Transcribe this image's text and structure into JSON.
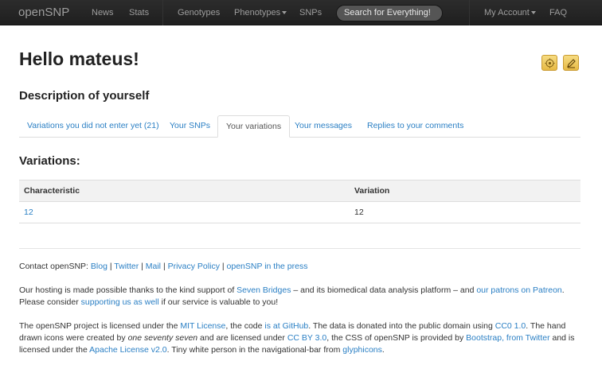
{
  "navbar": {
    "brand": "openSNP",
    "left_items": [
      "News",
      "Stats"
    ],
    "genotypes": "Genotypes",
    "phenotypes": "Phenotypes",
    "snps": "SNPs",
    "search_placeholder": "Search for Everything!",
    "account": "My Account",
    "faq": "FAQ"
  },
  "page": {
    "title": "Hello mateus!",
    "subtitle": "Description of yourself",
    "icons": [
      "settings-icon",
      "edit-icon"
    ]
  },
  "tabs": [
    {
      "label": "Variations you did not enter yet (21)",
      "active": false
    },
    {
      "label": "Your SNPs",
      "active": false
    },
    {
      "label": "Your variations",
      "active": true
    },
    {
      "label": "Your messages",
      "active": false
    },
    {
      "label": "Replies to your comments",
      "active": false
    }
  ],
  "variations": {
    "heading": "Variations:",
    "columns": [
      "Characteristic",
      "Variation"
    ],
    "rows": [
      [
        "12",
        "12"
      ]
    ]
  },
  "footer": {
    "contact_prefix": "Contact openSNP:",
    "contact_links": [
      "Blog",
      "Twitter",
      "Mail",
      "Privacy Policy",
      "openSNP in the press"
    ],
    "hosting": {
      "t1": "Our hosting is made possible thanks to the kind support of ",
      "l1": "Seven Bridges",
      "t2": " – and its biomedical data analysis platform – and ",
      "l2": "our patrons on Patreon",
      "t3": ". Please consider ",
      "l3": "supporting us as well",
      "t4": " if our service is valuable to you!"
    },
    "license": {
      "t1": "The openSNP project is licensed under the ",
      "l1": "MIT License",
      "t2": ", the code ",
      "l2": "is at GitHub",
      "t3": ". The data is donated into the public domain using ",
      "l3": "CC0 1.0",
      "t4": ". The hand drawn icons were created by ",
      "em1": "one seventy seven",
      "t5": " and are licensed under ",
      "l4": "CC BY 3.0",
      "t6": ", the CSS of openSNP is provided by ",
      "l5": "Bootstrap, from Twitter",
      "t7": " and is licensed under the ",
      "l6": "Apache License v2.0",
      "t8": ". Tiny white person in the navigational-bar from ",
      "l7": "glyphicons",
      "t9": "."
    }
  }
}
